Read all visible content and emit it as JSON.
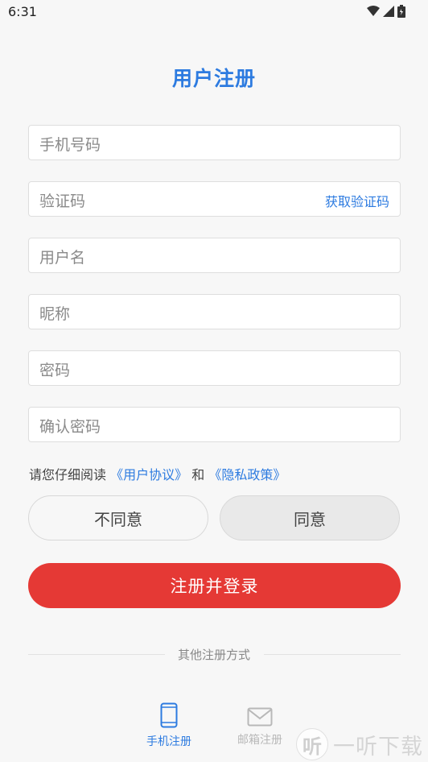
{
  "status_bar": {
    "time": "6:31",
    "wifi_icon": "wifi-icon",
    "signal_icon": "signal-icon",
    "battery_icon": "battery-icon"
  },
  "title": "用户注册",
  "fields": {
    "phone": {
      "placeholder": "手机号码"
    },
    "code": {
      "placeholder": "验证码",
      "get_code": "获取验证码"
    },
    "username": {
      "placeholder": "用户名"
    },
    "nickname": {
      "placeholder": "昵称"
    },
    "password": {
      "placeholder": "密码"
    },
    "confirm": {
      "placeholder": "确认密码"
    }
  },
  "agreement": {
    "prefix": "请您仔细阅读",
    "user_agreement": "《用户协议》",
    "and": "和",
    "privacy_policy": "《隐私政策》"
  },
  "buttons": {
    "disagree": "不同意",
    "agree": "同意",
    "register": "注册并登录"
  },
  "other": {
    "title": "其他注册方式"
  },
  "tabs": [
    {
      "label": "手机注册",
      "icon": "phone-icon",
      "active": true
    },
    {
      "label": "邮箱注册",
      "icon": "mail-icon",
      "active": false
    }
  ],
  "colors": {
    "accent": "#2d7be0",
    "primary_button": "#e53935",
    "background": "#f7f7f7"
  },
  "watermark": {
    "text": "一听下载",
    "logo_char": "听"
  }
}
